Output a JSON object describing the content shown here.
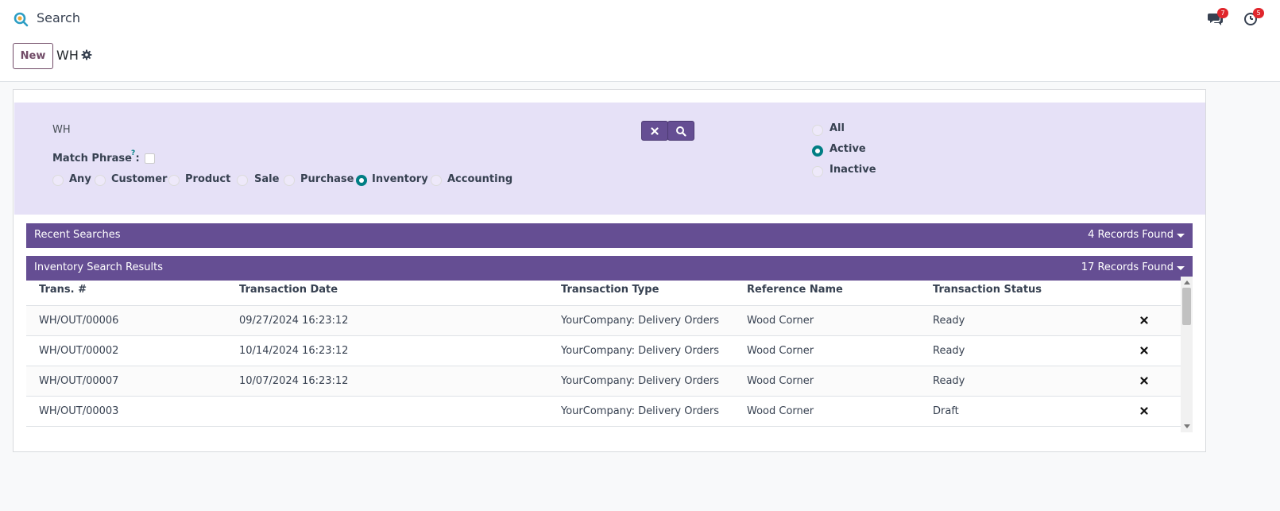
{
  "app": {
    "title": "Search"
  },
  "nav": {
    "messages_count": "7",
    "activities_count": "5"
  },
  "control": {
    "new_label": "New",
    "record_title": "WH"
  },
  "search": {
    "query": "WH",
    "match_phrase_label": "Match Phrase :",
    "match_phrase_help": "?",
    "categories": [
      "Any",
      "Customer",
      "Product",
      "Sale",
      "Purchase",
      "Inventory",
      "Accounting"
    ],
    "selected_category": "Inventory",
    "status_options": [
      "All",
      "Active",
      "Inactive"
    ],
    "selected_status": "Active"
  },
  "recent": {
    "title": "Recent Searches",
    "count": "4 Records Found"
  },
  "results": {
    "title": "Inventory Search Results",
    "count": "17 Records Found",
    "columns": [
      "Trans. #",
      "Transaction Date",
      "Transaction Type",
      "Reference Name",
      "Transaction Status"
    ],
    "rows": [
      {
        "trans": "WH/OUT/00006",
        "date": "09/27/2024 16:23:12",
        "type": "YourCompany: Delivery Orders",
        "ref": "Wood Corner",
        "status": "Ready"
      },
      {
        "trans": "WH/OUT/00002",
        "date": "10/14/2024 16:23:12",
        "type": "YourCompany: Delivery Orders",
        "ref": "Wood Corner",
        "status": "Ready"
      },
      {
        "trans": "WH/OUT/00007",
        "date": "10/07/2024 16:23:12",
        "type": "YourCompany: Delivery Orders",
        "ref": "Wood Corner",
        "status": "Ready"
      },
      {
        "trans": "WH/OUT/00003",
        "date": "",
        "type": "YourCompany: Delivery Orders",
        "ref": "Wood Corner",
        "status": "Draft"
      }
    ]
  },
  "icons": {
    "app_logo": "search-app-icon",
    "messages": "chat-icon",
    "activities": "clock-icon",
    "settings": "gear-icon",
    "clear": "close-icon",
    "search": "search-icon",
    "remove": "close-icon",
    "expand": "caret-down-icon"
  },
  "colors": {
    "accent": "#654e93",
    "brand": "#714b67",
    "teal": "#017e84",
    "panel": "#e6e1f7",
    "badge": "#e0262c"
  }
}
